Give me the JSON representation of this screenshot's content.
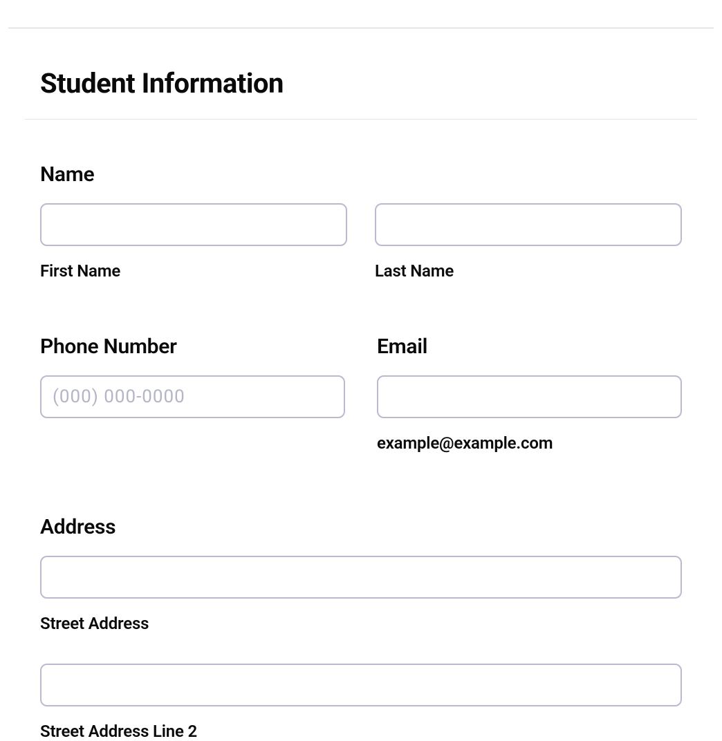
{
  "pageTitle": "Student Information",
  "name": {
    "label": "Name",
    "first": {
      "value": "",
      "sublabel": "First Name"
    },
    "last": {
      "value": "",
      "sublabel": "Last Name"
    }
  },
  "phone": {
    "label": "Phone Number",
    "placeholder": "(000) 000-0000",
    "value": ""
  },
  "email": {
    "label": "Email",
    "value": "",
    "sublabel": "example@example.com"
  },
  "address": {
    "label": "Address",
    "street1": {
      "value": "",
      "sublabel": "Street Address"
    },
    "street2": {
      "value": "",
      "sublabel": "Street Address Line 2"
    }
  }
}
